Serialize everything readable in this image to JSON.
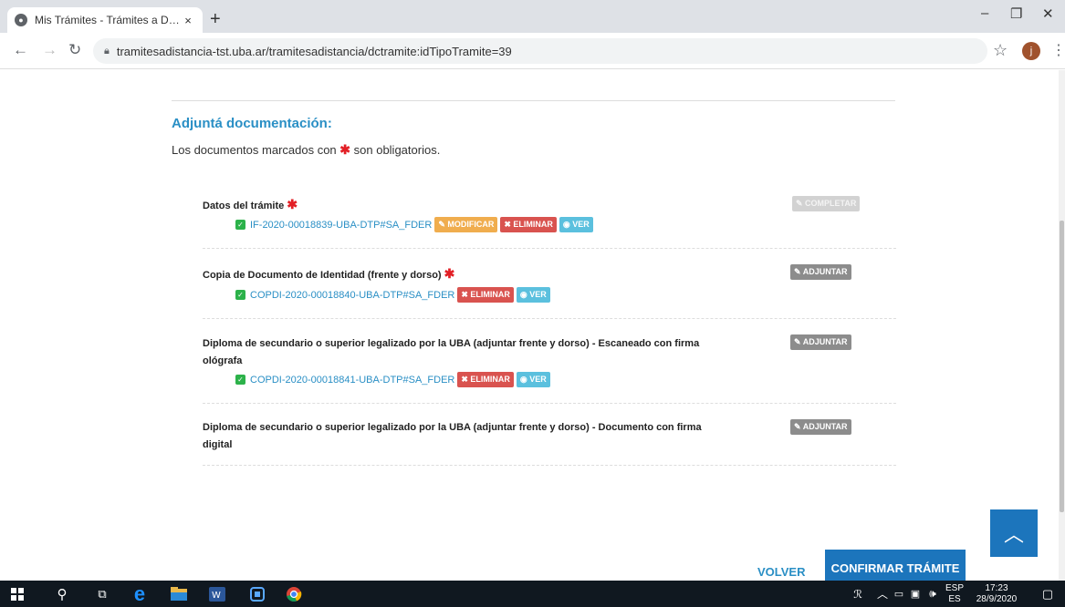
{
  "browser": {
    "tab_title": "Mis Trámites - Trámites a Distanc",
    "tab_close": "×",
    "new_tab": "+",
    "url": "tramitesadistancia-tst.uba.ar/tramitesadistancia/dctramite:idTipoTramite=39",
    "window_min": "–",
    "window_restore": "❐",
    "window_close": "✕",
    "avatar_letter": "j"
  },
  "page": {
    "section_title": "Adjuntá documentación:",
    "intro_prefix": "Los documentos marcados con",
    "intro_star": "✱",
    "intro_suffix": "son obligatorios.",
    "required_star": "✱",
    "documents": [
      {
        "name": "Datos del trámite",
        "required": true,
        "file": "IF-2020-00018839-UBA-DTP#SA_FDER",
        "actions": [
          "✎ MODIFICAR",
          "✖ ELIMINAR",
          "◉ VER"
        ],
        "side_button": "✎ COMPLETAR"
      },
      {
        "name": "Copia de Documento de Identidad (frente y dorso)",
        "required": true,
        "file": "COPDI-2020-00018840-UBA-DTP#SA_FDER",
        "actions": [
          "✖ ELIMINAR",
          "◉ VER"
        ],
        "side_button": "✎ ADJUNTAR"
      },
      {
        "name": "Diploma de secundario o superior legalizado por la UBA (adjuntar frente y dorso) - Escaneado con firma ológrafa",
        "required": false,
        "file": "COPDI-2020-00018841-UBA-DTP#SA_FDER",
        "actions": [
          "✖ ELIMINAR",
          "◉ VER"
        ],
        "side_button": "✎ ADJUNTAR"
      },
      {
        "name": "Diploma de secundario o superior legalizado por la UBA (adjuntar frente y dorso) - Documento con firma digital",
        "required": false,
        "side_button": "✎ ADJUNTAR"
      }
    ],
    "volver_label": "VOLVER",
    "confirmar_label": "CONFIRMAR TRÁMITE",
    "to_top": "︿"
  },
  "taskbar": {
    "language": "ESP",
    "language_sub": "ES",
    "time": "17:23",
    "date": "28/9/2020"
  },
  "colors": {
    "accent": "#2a8fc5",
    "primary_button": "#1c75bc",
    "required": "#e21f25",
    "success": "#2cb24a",
    "warning": "#f0ad4e",
    "danger": "#d9534f",
    "info": "#5bc0de"
  }
}
